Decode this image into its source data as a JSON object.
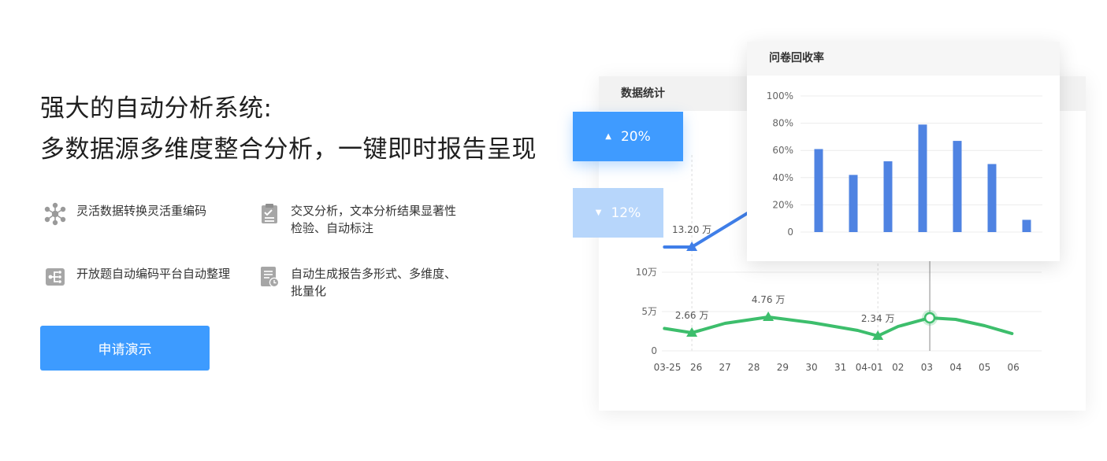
{
  "hero": {
    "line1": "强大的自动分析系统:",
    "line2": "多数据源多维度整合分析，一键即时报告呈现"
  },
  "features": [
    {
      "icon": "network-icon",
      "text": "灵活数据转换灵活重编码"
    },
    {
      "icon": "clipboard-check-icon",
      "text": "交叉分析，文本分析结果显著性检验、自动标注"
    },
    {
      "icon": "tree-structure-icon",
      "text": "开放题自动编码平台自动整理"
    },
    {
      "icon": "report-clock-icon",
      "text": "自动生成报告多形式、多维度、批量化"
    }
  ],
  "cta": {
    "label": "申请演示"
  },
  "stats_panel": {
    "title": "数据统计",
    "badge_up": {
      "value": "20%",
      "direction": "up",
      "color": "#3f9bff"
    },
    "badge_down": {
      "value": "12%",
      "direction": "down",
      "color": "#b7d6fb"
    }
  },
  "rate_panel": {
    "title": "问卷回收率"
  },
  "chart_data": [
    {
      "type": "line",
      "title": "",
      "categories": [
        "03-25",
        "26",
        "27",
        "28",
        "29",
        "30",
        "31",
        "04-01",
        "02",
        "03",
        "04",
        "05",
        "06"
      ],
      "y_ticks": [
        "0",
        "5万",
        "10万"
      ],
      "ylim": [
        0,
        15
      ],
      "y_unit": "万",
      "grid": true,
      "series": [
        {
          "color": "#3f7ee8",
          "points": [
            [
              -0.1,
              13.2
            ],
            [
              0.85,
              13.2
            ],
            [
              3.0,
              18.0
            ]
          ],
          "annotations": [
            {
              "x": 0.85,
              "y": 13.2,
              "label": "13.20 万"
            }
          ]
        },
        {
          "color": "#3dbe6c",
          "points": [
            [
              -0.1,
              2.85
            ],
            [
              0.85,
              2.3
            ],
            [
              2.0,
              3.5
            ],
            [
              3.5,
              4.3
            ],
            [
              5.0,
              3.6
            ],
            [
              6.6,
              2.6
            ],
            [
              7.3,
              1.9
            ],
            [
              8.0,
              3.1
            ],
            [
              9.1,
              4.2
            ],
            [
              10.0,
              4.0
            ],
            [
              11.0,
              3.2
            ],
            [
              11.95,
              2.2
            ]
          ],
          "annotations": [
            {
              "x": 0.85,
              "y": 2.3,
              "label": "2.66 万"
            },
            {
              "x": 3.5,
              "y": 4.3,
              "label": "4.76 万"
            },
            {
              "x": 7.3,
              "y": 1.9,
              "label": "2.34 万"
            }
          ],
          "highlight": {
            "x": 9.1,
            "y": 4.2
          }
        }
      ]
    },
    {
      "type": "bar",
      "title": "问卷回收率",
      "y_ticks": [
        "0",
        "20%",
        "40%",
        "60%",
        "80%",
        "100%"
      ],
      "ylim": [
        0,
        100
      ],
      "values": [
        61,
        42,
        52,
        79,
        67,
        50,
        9
      ],
      "color": "#4f83e2",
      "grid": true
    }
  ]
}
